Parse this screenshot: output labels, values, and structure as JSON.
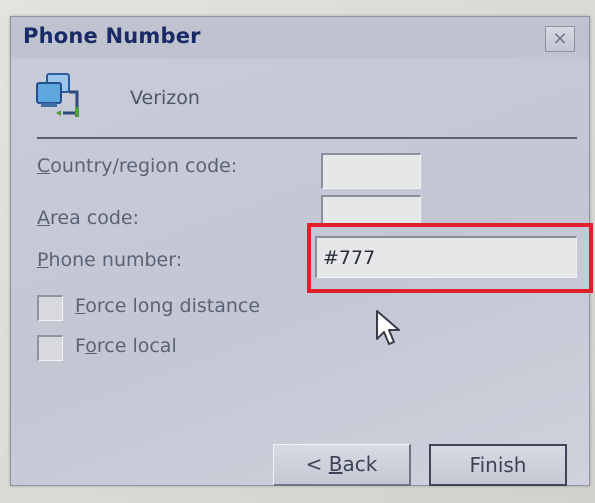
{
  "dialog": {
    "title": "Phone Number",
    "close_label": "×",
    "connection_name": "Verizon"
  },
  "form": {
    "country_label_accel": "C",
    "country_label_rest": "ountry/region code:",
    "country_value": "",
    "area_label_accel": "A",
    "area_label_rest": "rea code:",
    "area_value": "",
    "phone_label_accel": "P",
    "phone_label_rest": "hone number:",
    "phone_value": "#777"
  },
  "options": {
    "long_distance_accel": "F",
    "long_distance_rest": "orce long distance",
    "long_distance_checked": false,
    "local_prefix": "F",
    "local_accel": "o",
    "local_rest": "rce local",
    "local_checked": false
  },
  "buttons": {
    "back_prefix": "< ",
    "back_accel": "B",
    "back_rest": "ack",
    "finish_label": "Finish"
  },
  "colors": {
    "highlight": "#e0202b",
    "title_text": "#1a2a66"
  },
  "icons": {
    "connection": "network-connection-icon",
    "close": "close-icon",
    "pointer": "mouse-pointer-icon"
  }
}
